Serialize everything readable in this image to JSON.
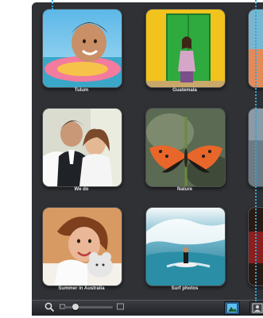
{
  "events": [
    {
      "label": "Tulum"
    },
    {
      "label": "Guatemala"
    },
    {
      "label": "We do"
    },
    {
      "label": "Nature"
    },
    {
      "label": "Summer in Australia"
    },
    {
      "label": "Surf photos"
    }
  ],
  "toolbar": {
    "search_icon": "magnifier-icon",
    "zoom_level": 0.2,
    "small_photo_icon": "small-photo-icon",
    "large_photo_icon": "large-photo-icon",
    "event_view_icon": "events-view-icon",
    "faces_view_icon": "faces-view-icon"
  },
  "colors": {
    "window_bg": "#2f3135",
    "guide_line": "#29a9e1",
    "label_text": "#e9e9e9"
  }
}
